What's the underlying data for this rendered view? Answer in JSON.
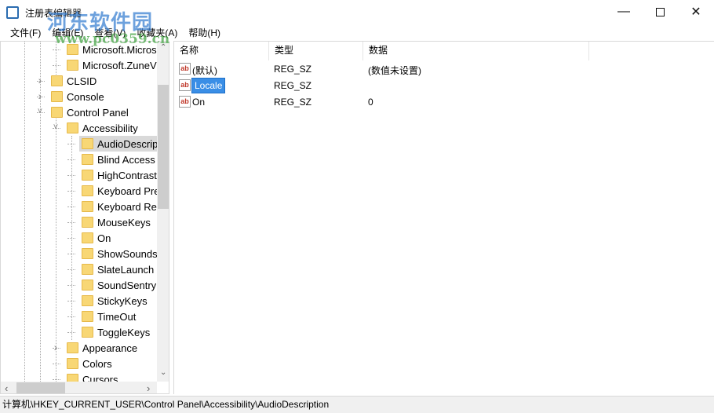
{
  "window": {
    "title": "注册表编辑器",
    "minimize_icon": "minimize-icon",
    "maximize_icon": "maximize-icon",
    "close_icon": "close-icon"
  },
  "watermark": {
    "name": "河东软件园",
    "url": "www.pc0359.cn"
  },
  "menu": [
    "文件(F)",
    "编辑(E)",
    "查看(V)",
    "收藏夹(A)",
    "帮助(H)"
  ],
  "tree": [
    {
      "label": "Microsoft.Micros",
      "level": 2,
      "expander": "none"
    },
    {
      "label": "Microsoft.ZuneV",
      "level": 2,
      "expander": "none"
    },
    {
      "label": "CLSID",
      "level": 1,
      "expander": "collapsed"
    },
    {
      "label": "Console",
      "level": 1,
      "expander": "collapsed"
    },
    {
      "label": "Control Panel",
      "level": 1,
      "expander": "expanded"
    },
    {
      "label": "Accessibility",
      "level": 2,
      "expander": "expanded"
    },
    {
      "label": "AudioDescrip",
      "level": 3,
      "expander": "none",
      "selected": true
    },
    {
      "label": "Blind Access",
      "level": 3,
      "expander": "none"
    },
    {
      "label": "HighContrast",
      "level": 3,
      "expander": "none"
    },
    {
      "label": "Keyboard Pre",
      "level": 3,
      "expander": "none"
    },
    {
      "label": "Keyboard Re",
      "level": 3,
      "expander": "none"
    },
    {
      "label": "MouseKeys",
      "level": 3,
      "expander": "none"
    },
    {
      "label": "On",
      "level": 3,
      "expander": "none"
    },
    {
      "label": "ShowSounds",
      "level": 3,
      "expander": "none"
    },
    {
      "label": "SlateLaunch",
      "level": 3,
      "expander": "none"
    },
    {
      "label": "SoundSentry",
      "level": 3,
      "expander": "none"
    },
    {
      "label": "StickyKeys",
      "level": 3,
      "expander": "none"
    },
    {
      "label": "TimeOut",
      "level": 3,
      "expander": "none"
    },
    {
      "label": "ToggleKeys",
      "level": 3,
      "expander": "none"
    },
    {
      "label": "Appearance",
      "level": 2,
      "expander": "collapsed"
    },
    {
      "label": "Colors",
      "level": 2,
      "expander": "none"
    },
    {
      "label": "Cursors",
      "level": 2,
      "expander": "none"
    }
  ],
  "list": {
    "headers": [
      "名称",
      "类型",
      "数据"
    ],
    "rows": [
      {
        "name": "(默认)",
        "type": "REG_SZ",
        "data": "(数值未设置)",
        "icon": "string-value-icon"
      },
      {
        "name": "Locale",
        "type": "REG_SZ",
        "data": "",
        "icon": "string-value-icon",
        "editing": true
      },
      {
        "name": "On",
        "type": "REG_SZ",
        "data": "0",
        "icon": "string-value-icon"
      }
    ]
  },
  "status": "计算机\\HKEY_CURRENT_USER\\Control Panel\\Accessibility\\AudioDescription",
  "colors": {
    "selection": "#3a8ee6",
    "folder": "#f8d775"
  }
}
